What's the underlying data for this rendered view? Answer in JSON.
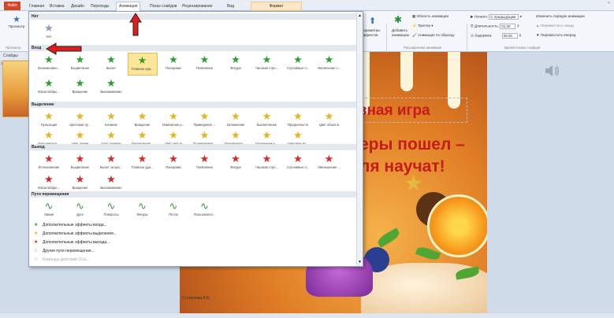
{
  "tabs": {
    "file": "Файл",
    "items": [
      "Главная",
      "Вставка",
      "Дизайн",
      "Переходы",
      "Анимация",
      "Показ слайдов",
      "Рецензирование",
      "Вид"
    ],
    "format": "Формат"
  },
  "ribbon": {
    "preview": "Просмотр",
    "preview_group": "Просмотр",
    "effect_params": [
      "Параметры",
      "эффектов"
    ],
    "add_anim": [
      "Добавить",
      "анимацию"
    ],
    "anim_area": "Область анимации",
    "trigger": "Триггер",
    "anim_painter": "Анимация по образцу",
    "adv_group": "Расширенная анимация",
    "start_label": "Начало:",
    "start_value": "С предыдущим",
    "duration_label": "Длительность:",
    "duration_value": "01,00",
    "delay_label": "Задержка:",
    "delay_value": "00,00",
    "timing_group": "Время показа слайдов",
    "reorder": "Изменить порядок анимации",
    "move_earlier": "Переместить назад",
    "move_later": "Переместить вперед"
  },
  "left": {
    "slides_tab": "Слайды",
    "num": "1"
  },
  "panel": {
    "none_header": "Нет",
    "none_label": "Нет",
    "entrance_header": "Вход",
    "entrance_items": [
      "Возникновен...",
      "Выцветание",
      "Вылет",
      "Плавное при...",
      "Панорама",
      "Появление",
      "Фигура",
      "Часовая стре...",
      "Случайные п...",
      "Увеличение с..."
    ],
    "entrance_items2": [
      "Масштабиро...",
      "Вращение",
      "Выскакивание"
    ],
    "emphasis_header": "Выделение",
    "emphasis_items": [
      "Пульсация",
      "Цветовая пу...",
      "Качание",
      "Вращение",
      "Изменение р...",
      "Приведение ...",
      "Затемнение",
      "Высветление",
      "Прозрачность",
      "Цвет объекта"
    ],
    "emphasis_items2": [
      "Дополнитель...",
      "Цвет линии",
      "Цвет заливки",
      "Перекрашив...",
      "Цвет текста",
      "Подчеркиван...",
      "Полужирное ...",
      "Наложение ч...",
      "Цветовая во..."
    ],
    "exit_header": "Выход",
    "exit_items": [
      "Исчезновение",
      "Выцветание",
      "Вылет за кра...",
      "Плавное уда...",
      "Панорама",
      "Появление",
      "Фигура",
      "Часовая стре...",
      "Случайные п...",
      "Уменьшение ..."
    ],
    "exit_items2": [
      "Масштабиро...",
      "Вращение",
      "Выскакивание"
    ],
    "paths_header": "Пути перемещения",
    "paths_items": [
      "Линии",
      "Дуги",
      "Повороты",
      "Фигуры",
      "Петли",
      "Пользовател..."
    ],
    "more_items": [
      "Дополнительные эффекты входа...",
      "Дополнительные эффекты выделения...",
      "Дополнительные эффекты выхода...",
      "Другие пути перемещения...",
      "Команды действий OLE..."
    ]
  },
  "slide": {
    "title1": "зная игра",
    "title2": "еры пошел –",
    "title3": "ля научат!",
    "credit": "Стопелева А.Б."
  },
  "colors": {
    "entrance": "#2e9e2e",
    "emphasis": "#e6b420",
    "exit": "#d42a2a",
    "annotation_arrow": "#e21b1b"
  }
}
